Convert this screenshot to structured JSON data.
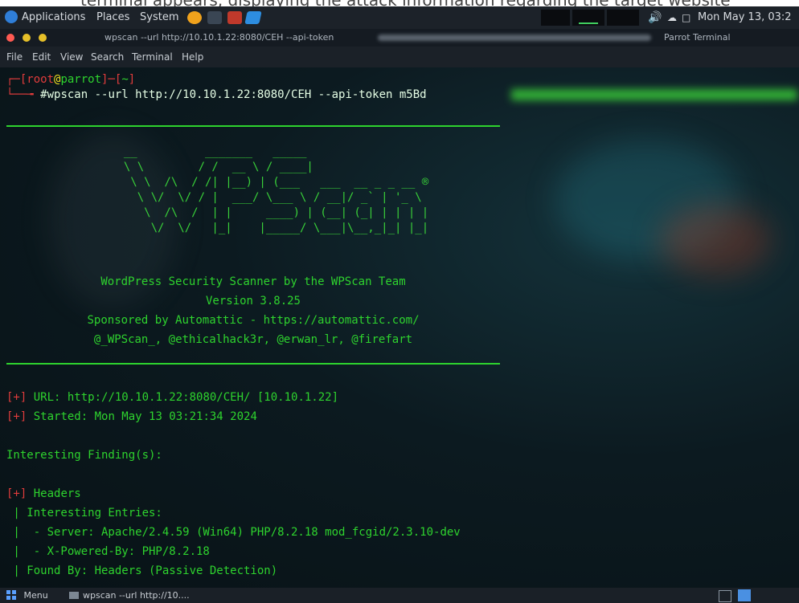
{
  "caption": {
    "text": "terminal appears, displaying the attack information regarding the target website"
  },
  "panel": {
    "applications": "Applications",
    "places": "Places",
    "system": "System",
    "clock": "Mon May 13, 03:2"
  },
  "window": {
    "title": "wpscan --url http://10.10.1.22:8080/CEH --api-token",
    "app_name": "Parrot Terminal"
  },
  "menu": [
    "File",
    "Edit",
    "View",
    "Search",
    "Terminal",
    "Help"
  ],
  "terminal": {
    "prompt_user": "root",
    "prompt_host": "parrot",
    "prompt_dir": "~",
    "command": "#wpscan --url http://10.10.1.22:8080/CEH --api-token m5Bd",
    "banner": "         __          _______   _____\n         \\ \\        / /  __ \\ / ____|\n          \\ \\  /\\  / /| |__) | (___   ___  __ _ _ __ ®\n           \\ \\/  \\/ / |  ___/ \\___ \\ / __|/ _` | '_ \\\n            \\  /\\  /  | |     ____) | (__| (_| | | | |\n             \\/  \\/   |_|    |_____/ \\___|\\__,_|_| |_|",
    "tagline": "WordPress Security Scanner by the WPScan Team",
    "version": "Version 3.8.25",
    "sponsor": "Sponsored by Automattic - https://automattic.com/",
    "authors": "@_WPScan_, @ethicalhack3r, @erwan_lr, @firefart",
    "url_prefix": "[+]",
    "url_line": " URL: http://10.10.1.22:8080/CEH/ [10.10.1.22]",
    "started_prefix": "[+]",
    "started_line": " Started: Mon May 13 03:21:34 2024",
    "findings_heading": "Interesting Finding(s):",
    "headers_prefix": "[+]",
    "headers_label": " Headers",
    "entries": [
      " | Interesting Entries:",
      " |  - Server: Apache/2.4.59 (Win64) PHP/8.2.18 mod_fcgid/2.3.10-dev",
      " |  - X-Powered-By: PHP/8.2.18",
      " | Found By: Headers (Passive Detection)"
    ]
  },
  "taskbar": {
    "menu": "Menu",
    "task": "wpscan --url http://10...."
  }
}
